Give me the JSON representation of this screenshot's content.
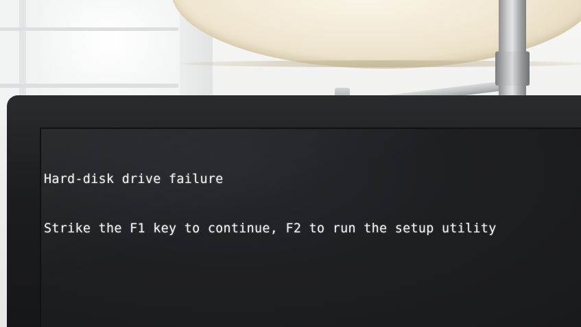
{
  "screen": {
    "lines": [
      "Hard-disk drive failure",
      "Strike the F1 key to continue, F2 to run the setup utility"
    ]
  },
  "colors": {
    "screen_background": "#1e1f23",
    "text": "#f3f3f3",
    "bezel": "#1c1d1f"
  }
}
